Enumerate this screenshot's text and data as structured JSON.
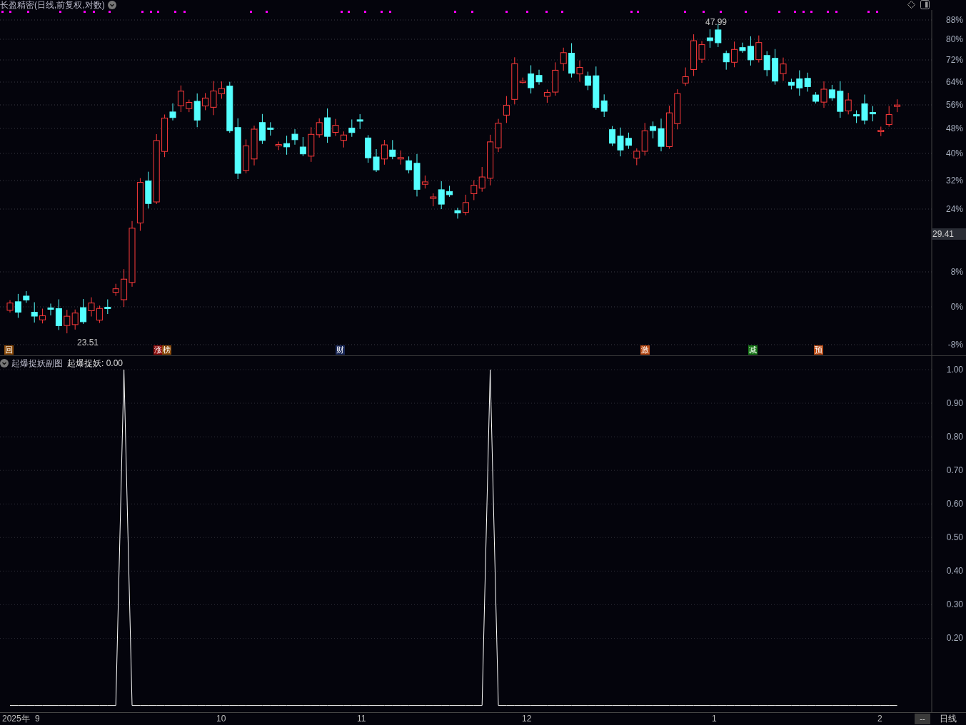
{
  "price_chart": {
    "title": "长盈精密(日线,前复权,对数)",
    "axis_labels": [
      "88%",
      "80%",
      "72%",
      "64%",
      "56%",
      "48%",
      "40%",
      "32%",
      "24%",
      "8%",
      "0%",
      "-8%"
    ],
    "current_price": "29.41",
    "high_label": "47.99",
    "low_label": "23.51",
    "markers": [
      {
        "text": "回",
        "color": "#8a4a0a"
      },
      {
        "text": "涨",
        "color": "#8b0a0a"
      },
      {
        "text": "榜",
        "color": "#8a4a0a"
      },
      {
        "text": "财",
        "color": "#1c2a5a"
      },
      {
        "text": "激",
        "color": "#b84a14"
      },
      {
        "text": "减",
        "color": "#187818"
      },
      {
        "text": "预",
        "color": "#b84a14"
      }
    ]
  },
  "indicator_panel": {
    "title": "起爆捉妖副图",
    "reading": ": 0.00",
    "chart_data": {
      "type": "line",
      "grid": true,
      "ylim": [
        -0.02,
        1
      ],
      "yticks": [
        {
          "value": 1,
          "label": "1.00"
        },
        {
          "value": 0.9,
          "label": "0.90"
        },
        {
          "value": 0.8,
          "label": "0.80"
        },
        {
          "value": 0.7,
          "label": "0.70"
        },
        {
          "value": 0.6,
          "label": "0.60"
        },
        {
          "value": 0.5,
          "label": "0.50"
        },
        {
          "value": 0.4,
          "label": "0.40"
        },
        {
          "value": 0.3,
          "label": "0.30"
        },
        {
          "value": 0.2,
          "label": "0.20"
        }
      ],
      "series": [
        {
          "name": "起爆捉妖",
          "color": "#ffffff",
          "values": [
            0,
            0,
            0,
            0,
            0,
            0,
            0,
            0,
            0,
            0,
            0,
            0,
            0,
            0,
            1,
            0,
            0,
            0,
            0,
            0,
            0,
            0,
            0,
            0,
            0,
            0,
            0,
            0,
            0,
            0,
            0,
            0,
            0,
            0,
            0,
            0,
            0,
            0,
            0,
            0,
            0,
            0,
            0,
            0,
            0,
            0,
            0,
            0,
            0,
            0,
            0,
            0,
            0,
            0,
            0,
            0,
            0,
            0,
            0,
            1,
            0,
            0,
            0,
            0,
            0,
            0,
            0,
            0,
            0,
            0,
            0,
            0,
            0,
            0,
            0,
            0,
            0,
            0,
            0,
            0,
            0,
            0,
            0,
            0,
            0,
            0,
            0,
            0,
            0,
            0,
            0,
            0,
            0,
            0,
            0,
            0,
            0,
            0,
            0,
            0,
            0,
            0,
            0,
            0,
            0,
            0,
            0,
            0,
            0,
            0
          ]
        }
      ]
    }
  },
  "x_axis": {
    "labels": [
      "2025年",
      "9",
      "10",
      "11",
      "12",
      "1",
      "2"
    ],
    "scroll_button": "--",
    "period": "日线"
  }
}
